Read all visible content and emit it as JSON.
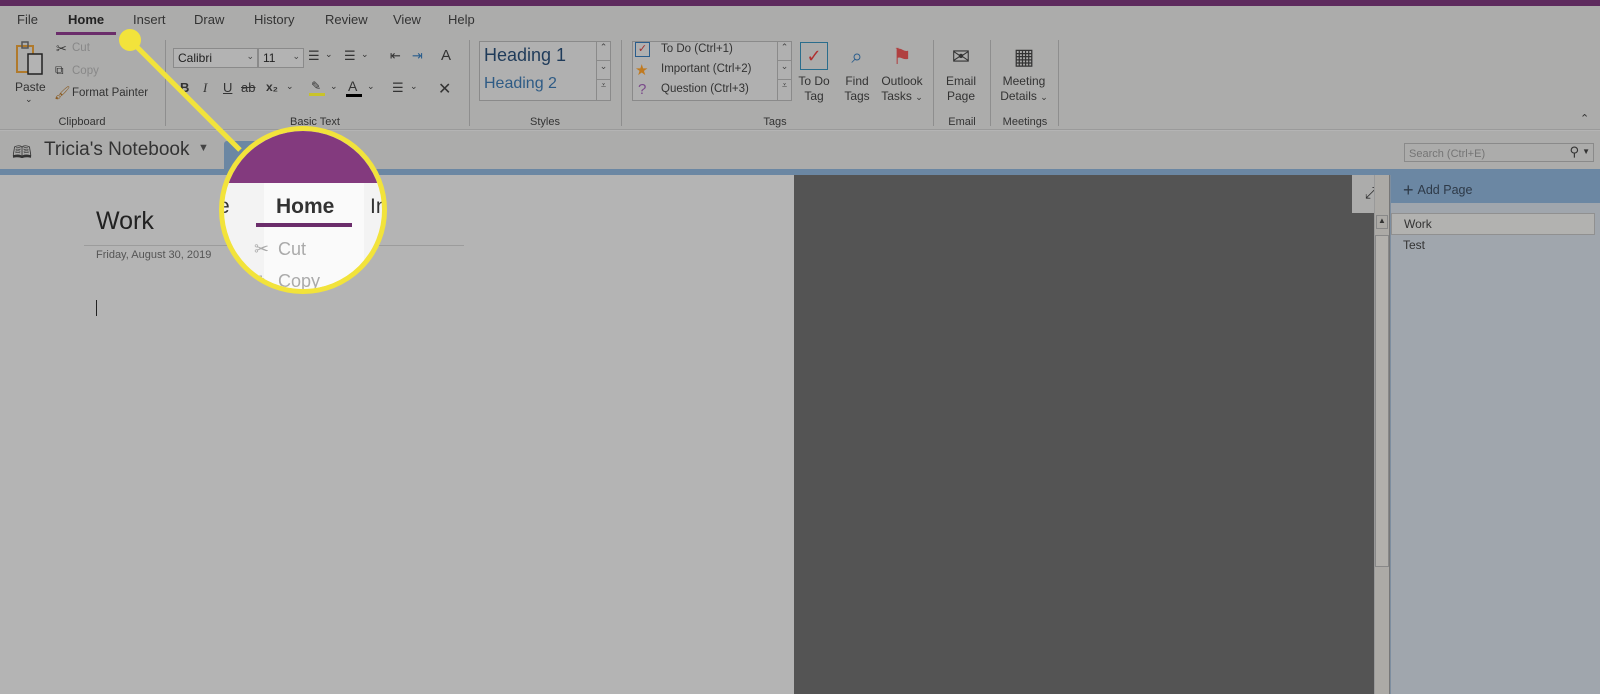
{
  "colors": {
    "brand_purple": "#6b2d6b",
    "nav_blue": "#6b87a3",
    "highlight_yellow": "#f2e33b"
  },
  "menu": {
    "tabs": [
      {
        "label": "File"
      },
      {
        "label": "Home",
        "active": true
      },
      {
        "label": "Insert"
      },
      {
        "label": "Draw"
      },
      {
        "label": "History"
      },
      {
        "label": "Review"
      },
      {
        "label": "View"
      },
      {
        "label": "Help"
      }
    ]
  },
  "ribbon": {
    "clipboard": {
      "paste": "Paste",
      "cut": "Cut",
      "copy": "Copy",
      "format_painter": "Format Painter",
      "label": "Clipboard"
    },
    "basic_text": {
      "font": "Calibri",
      "size": "11",
      "label": "Basic Text",
      "bold": "B",
      "italic": "I",
      "underline": "U",
      "strike": "ab",
      "subscript": "x₂"
    },
    "styles": {
      "items": [
        "Heading 1",
        "Heading 2"
      ],
      "label": "Styles"
    },
    "tags": {
      "items": [
        "To Do (Ctrl+1)",
        "Important (Ctrl+2)",
        "Question (Ctrl+3)"
      ],
      "label": "Tags",
      "todo_tag": [
        "To Do",
        "Tag"
      ],
      "find_tags": [
        "Find",
        "Tags"
      ],
      "outlook_tasks": [
        "Outlook",
        "Tasks"
      ]
    },
    "email": {
      "button": [
        "Email",
        "Page"
      ],
      "label": "Email"
    },
    "meetings": {
      "button": [
        "Meeting",
        "Details"
      ],
      "label": "Meetings"
    }
  },
  "nav": {
    "notebook": "Tricia's Notebook",
    "search_placeholder": "Search (Ctrl+E)"
  },
  "page": {
    "title": "Work",
    "date": "Friday, August 30, 2019"
  },
  "pages_panel": {
    "add_page": "Add Page",
    "pages": [
      {
        "label": "Work",
        "selected": true
      },
      {
        "label": "Test"
      }
    ]
  },
  "magnifier": {
    "left_fragment": "e",
    "tab": "Home",
    "right_fragment": "In",
    "cut": "Cut",
    "copy": "Copy"
  }
}
